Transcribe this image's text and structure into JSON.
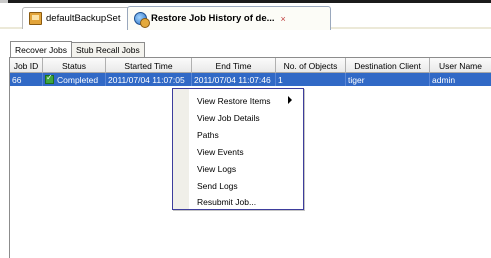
{
  "colors": {
    "selection": "#3169c6",
    "menu_border": "#3d3d9c",
    "status_ok": "#3fa53f",
    "tab_close_active": "#c04040"
  },
  "doc_tabs": [
    {
      "label": "defaultBackupSet",
      "icon": "backupset-icon",
      "close": "×"
    },
    {
      "label": "Restore Job History of de...",
      "icon": "restore-history-icon",
      "close": "×",
      "active": true
    }
  ],
  "sub_tabs": [
    {
      "label": "Recover Jobs",
      "active": true
    },
    {
      "label": "Stub Recall Jobs",
      "active": false
    }
  ],
  "table": {
    "columns": [
      "Job ID",
      "Status",
      "Started Time",
      "End Time",
      "No. of Objects",
      "Destination Client",
      "User Name"
    ],
    "rows": [
      {
        "job_id": "66",
        "status": "Completed",
        "status_icon": "completed-check-icon",
        "started_time": "2011/07/04 11:07:05",
        "end_time": "2011/07/04 11:07:46",
        "objects": "1",
        "destination": "tiger",
        "user": "admin",
        "selected": true
      }
    ]
  },
  "context_menu": {
    "items": [
      {
        "label": "View Restore Items",
        "submenu": true
      },
      {
        "label": "View Job Details"
      },
      {
        "label": "Paths"
      },
      {
        "label": "View Events"
      },
      {
        "label": "View Logs"
      },
      {
        "label": "Send Logs"
      },
      {
        "label": "Resubmit Job..."
      }
    ]
  }
}
